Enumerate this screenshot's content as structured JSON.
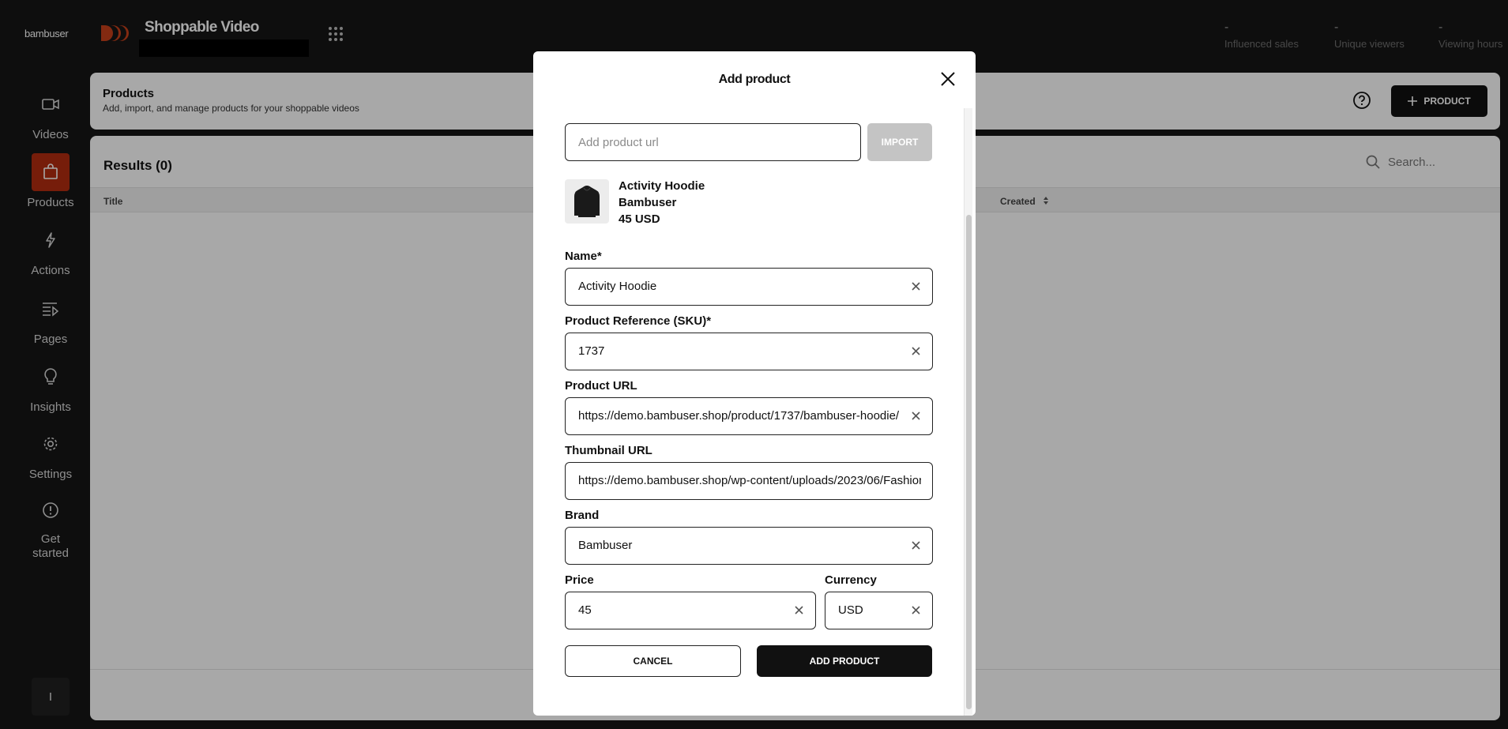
{
  "topbar": {
    "brand": "bambuser",
    "app_title": "Shoppable Video",
    "stats": [
      {
        "value": "-",
        "label": "Influenced sales"
      },
      {
        "value": "-",
        "label": "Unique viewers"
      },
      {
        "value": "-",
        "label": "Viewing hours"
      }
    ]
  },
  "sidebar": {
    "items": [
      {
        "label": "Videos",
        "icon": "video-icon"
      },
      {
        "label": "Products",
        "icon": "shopping-bag-icon",
        "active": true
      },
      {
        "label": "Actions",
        "icon": "lightning-icon"
      },
      {
        "label": "Pages",
        "icon": "pages-icon"
      },
      {
        "label": "Insights",
        "icon": "lightbulb-icon"
      },
      {
        "label": "Settings",
        "icon": "gear-icon"
      },
      {
        "label": "Get started",
        "icon": "info-icon"
      }
    ],
    "user_initial": "I"
  },
  "header": {
    "title": "Products",
    "description": "Add, import, and manage products for your shoppable videos",
    "add_button": "PRODUCT"
  },
  "results": {
    "title": "Results (0)",
    "search_placeholder": "Search...",
    "columns": [
      "Title",
      "Created"
    ]
  },
  "modal": {
    "title": "Add product",
    "url_placeholder": "Add product url",
    "import_label": "IMPORT",
    "preview": {
      "name": "Activity Hoodie",
      "brand": "Bambuser",
      "price": "45 USD"
    },
    "fields": {
      "name": {
        "label": "Name*",
        "value": "Activity Hoodie"
      },
      "sku": {
        "label": "Product Reference (SKU)*",
        "value": "1737"
      },
      "product_url": {
        "label": "Product URL",
        "value": "https://demo.bambuser.shop/product/1737/bambuser-hoodie/"
      },
      "thumbnail_url": {
        "label": "Thumbnail URL",
        "value": "https://demo.bambuser.shop/wp-content/uploads/2023/06/Fashion"
      },
      "brand": {
        "label": "Brand",
        "value": "Bambuser"
      },
      "price": {
        "label": "Price",
        "value": "45"
      },
      "currency": {
        "label": "Currency",
        "value": "USD"
      }
    },
    "cancel_label": "CANCEL",
    "confirm_label": "ADD PRODUCT"
  },
  "colors": {
    "accent": "#b32d10",
    "background": "#161616",
    "primary_button": "#111111",
    "disabled_button": "#c4c4c4"
  }
}
